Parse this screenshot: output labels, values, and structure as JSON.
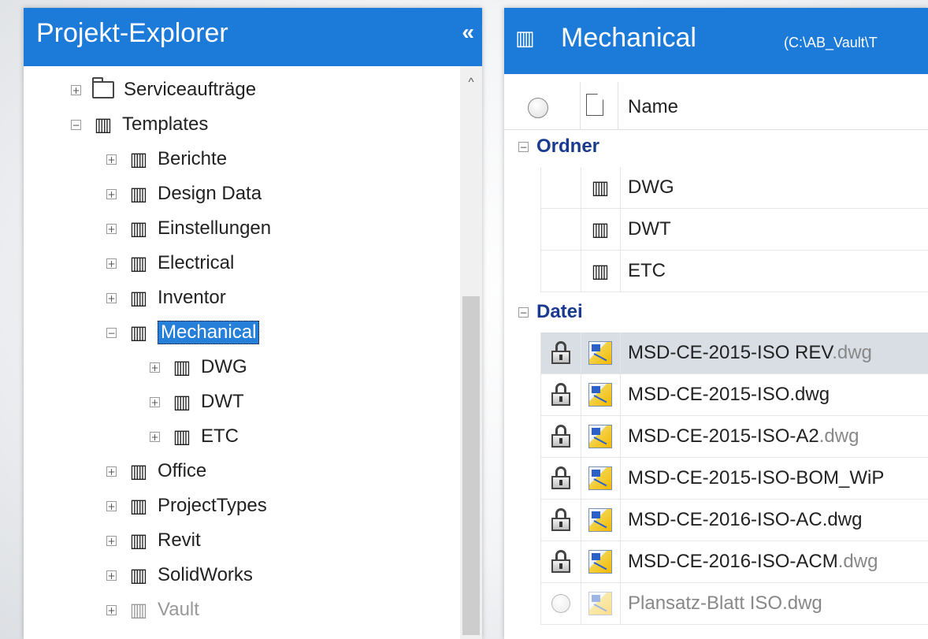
{
  "explorer": {
    "title": "Projekt-Explorer",
    "collapse_glyph": "«",
    "scroll_up_glyph": "^",
    "nodes": [
      {
        "label": "Serviceaufträge",
        "toggle": "+"
      },
      {
        "label": "Templates",
        "toggle": "−"
      },
      {
        "label": "Berichte",
        "toggle": "+"
      },
      {
        "label": "Design Data",
        "toggle": "+"
      },
      {
        "label": "Einstellungen",
        "toggle": "+"
      },
      {
        "label": "Electrical",
        "toggle": "+"
      },
      {
        "label": "Inventor",
        "toggle": "+"
      },
      {
        "label": "Mechanical",
        "toggle": "−"
      },
      {
        "label": "DWG",
        "toggle": "+"
      },
      {
        "label": "DWT",
        "toggle": "+"
      },
      {
        "label": "ETC",
        "toggle": "+"
      },
      {
        "label": "Office",
        "toggle": "+"
      },
      {
        "label": "ProjectTypes",
        "toggle": "+"
      },
      {
        "label": "Revit",
        "toggle": "+"
      },
      {
        "label": "SolidWorks",
        "toggle": "+"
      },
      {
        "label": "Vault",
        "toggle": "+"
      }
    ]
  },
  "folder_glyph": "▥",
  "content": {
    "title": "Mechanical",
    "path": "(C:\\AB_Vault\\T",
    "column_name": "Name",
    "groups": {
      "ordner": {
        "label": "Ordner",
        "toggle": "−"
      },
      "datei": {
        "label": "Datei",
        "toggle": "−"
      }
    },
    "folders": [
      "DWG",
      "DWT",
      "ETC"
    ],
    "files": [
      {
        "base": "MSD-CE-2015-ISO REV",
        "ext": ".dwg"
      },
      {
        "base": "MSD-CE-2015-ISO",
        "ext": ".dwg"
      },
      {
        "base": "MSD-CE-2015-ISO-A2",
        "ext": ".dwg"
      },
      {
        "base": "MSD-CE-2015-ISO-BOM_WiP",
        "ext": ""
      },
      {
        "base": "MSD-CE-2016-ISO-AC",
        "ext": ".dwg"
      },
      {
        "base": "MSD-CE-2016-ISO-ACM",
        "ext": ".dwg"
      },
      {
        "base": "Plansatz-Blatt ISO",
        "ext": ".dwg"
      }
    ]
  }
}
